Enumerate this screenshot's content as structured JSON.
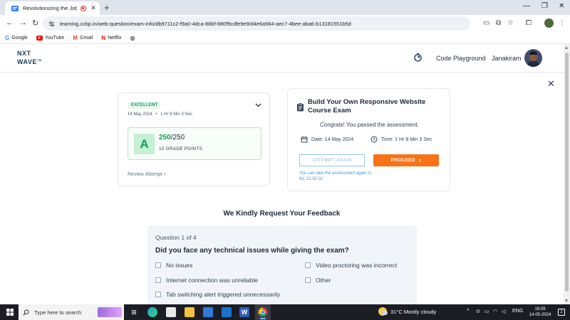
{
  "browser": {
    "tab_title": "Revolutionizing the Job Ma",
    "url": "learning.ccbp.in/web-question/exam-info/db9711c2-f9a0-4dca-88bf-880f9cdfe9e9/d4e6a564-aec7-4bee-aba6-b13181551b5d",
    "bookmarks": [
      "Google",
      "YouTube",
      "Gmail",
      "Netflix"
    ]
  },
  "header": {
    "logo_line1": "NXT",
    "logo_line2": "WAVE",
    "logo_tm": "TM",
    "code_playground": "Code Playground",
    "username": "Janakiram"
  },
  "result": {
    "badge": "EXCELLENT",
    "date": "14 May 2024",
    "separator": "•",
    "duration": "1 Hr 8 Min 3 Sec",
    "grade": "A",
    "score_obtained": "250",
    "score_total": "/250",
    "grade_points": "10 GRADE POINTS",
    "review_label": "Review Attempt",
    "review_chevron": "›"
  },
  "course": {
    "title": "Build Your Own Responsive Website Course Exam",
    "congrats": "Congrats! You passed the assessment.",
    "date": "Date: 14 May 2024",
    "time": "Time: 1 Hr 8 Min 3 Sec",
    "attempt_again": "ATTEMPT AGAIN",
    "proceed": "PROCEED",
    "proceed_chevron": "›",
    "retake_note": "You can take the assessment again in 6d, 22:50:31"
  },
  "feedback": {
    "heading": "We Kindly Request Your Feedback",
    "question_count": "Question 1 of 4",
    "question": "Did you face any technical issues while giving the exam?",
    "options": [
      "No issues",
      "Video proctoring was incorrect",
      "Internet connection was unreliable",
      "Other",
      "Tab switching alert triggered unnecessarily"
    ]
  },
  "taskbar": {
    "search_placeholder": "Type here to search",
    "weather": "31°C  Mostly cloudy",
    "lang": "ENG",
    "time": "19:09",
    "date": "14-05-2024",
    "notifications": "2"
  },
  "colors": {
    "accent_orange": "#f97316",
    "success_green": "#0e9f4f",
    "link_blue": "#3b9bd6"
  }
}
